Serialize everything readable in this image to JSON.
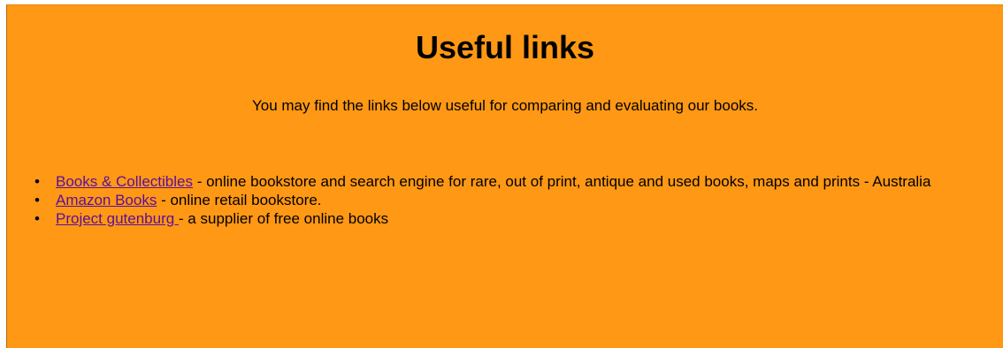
{
  "page": {
    "title": "Useful links",
    "intro": "You may find the links below useful for comparing and evaluating our books."
  },
  "links": [
    {
      "label": "Books & Collectibles",
      "description": " - online bookstore and search engine for rare, out of print, antique and used books, maps and prints - Australia"
    },
    {
      "label": "Amazon Books",
      "description": " - online retail bookstore."
    },
    {
      "label": "Project gutenburg ",
      "description": "- a supplier of free online books"
    }
  ],
  "colors": {
    "background": "#ff9814",
    "link": "#5a0f9c",
    "text": "#000000"
  },
  "icons": {
    "bullet": "bullet-icon"
  }
}
